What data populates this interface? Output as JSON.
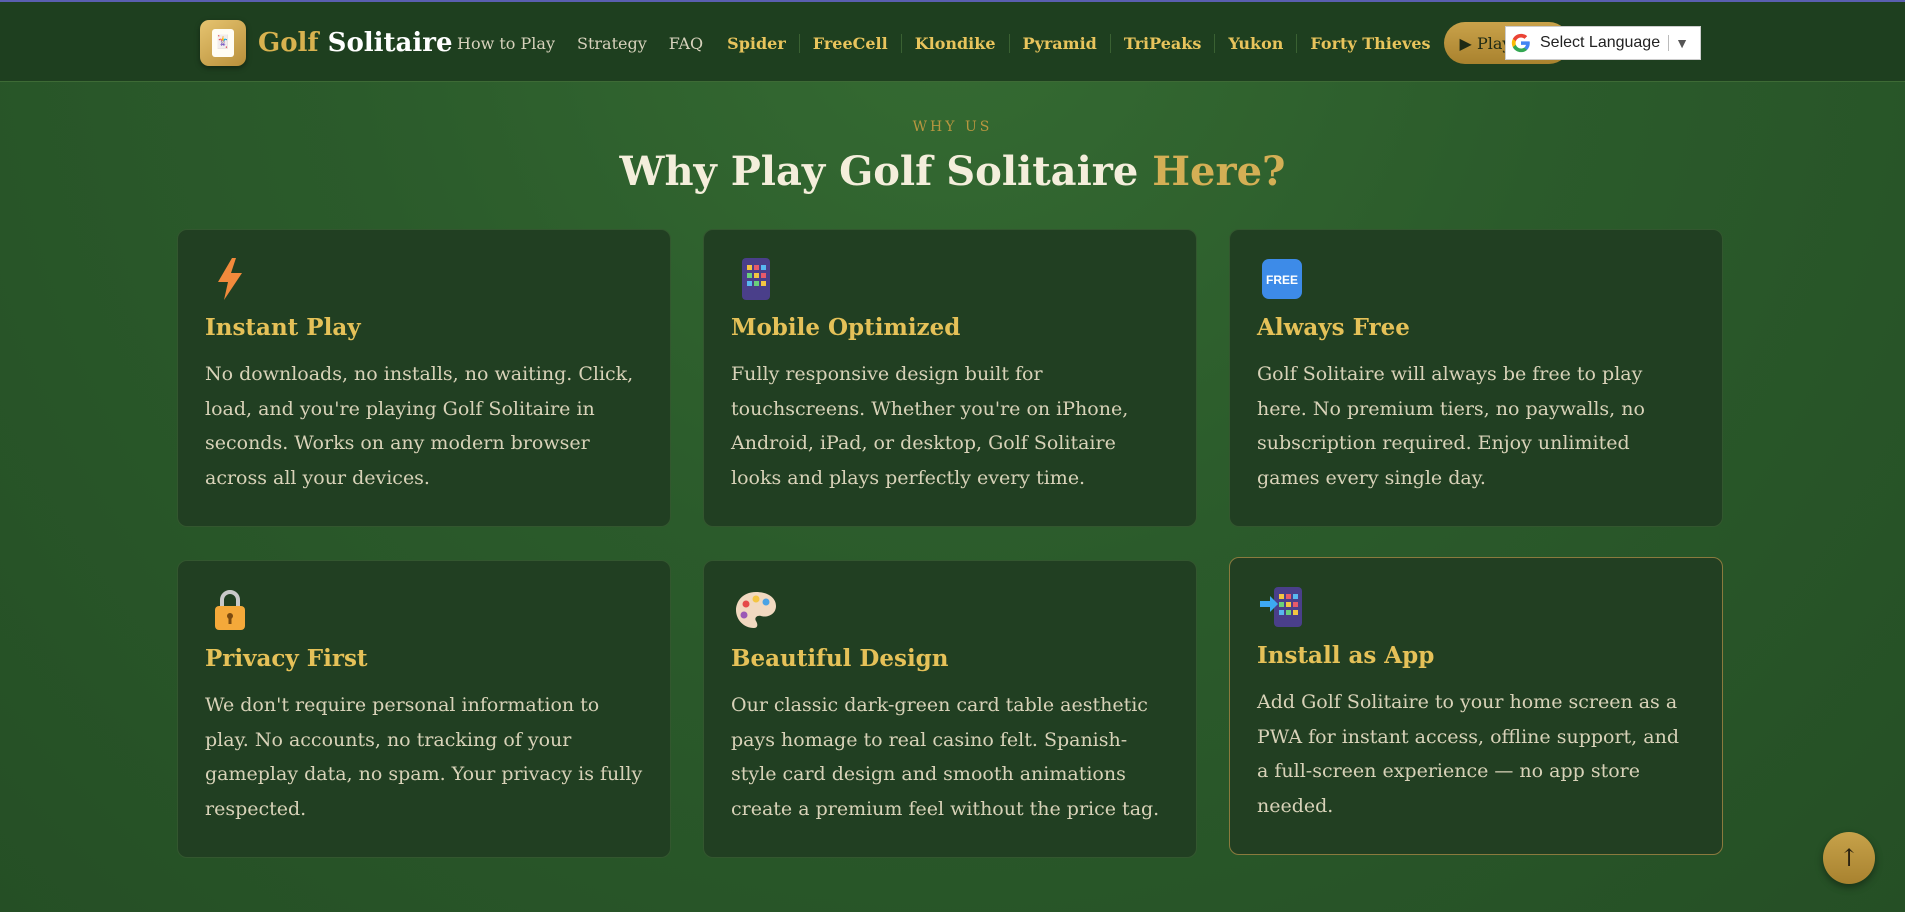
{
  "header": {
    "logo_golf": "Golf",
    "logo_solitaire": "Solitaire",
    "nav": [
      "How to Play",
      "Strategy",
      "FAQ"
    ],
    "games": [
      "Spider",
      "FreeCell",
      "Klondike",
      "Pyramid",
      "TriPeaks",
      "Yukon",
      "Forty Thieves"
    ],
    "play_button": "▶ Play Free",
    "language": "Select Language",
    "language_arrow": "▼"
  },
  "section": {
    "eyebrow": "WHY US",
    "title_main": "Why Play Golf Solitaire ",
    "title_accent": "Here?"
  },
  "cards": [
    {
      "icon": "lightning-icon",
      "title": "Instant Play",
      "text": "No downloads, no installs, no waiting. Click, load, and you're playing Golf Solitaire in seconds. Works on any modern browser across all your devices."
    },
    {
      "icon": "mobile-phone-icon",
      "title": "Mobile Optimized",
      "text": "Fully responsive design built for touchscreens. Whether you're on iPhone, Android, iPad, or desktop, Golf Solitaire looks and plays perfectly every time."
    },
    {
      "icon": "free-badge-icon",
      "title": "Always Free",
      "text": "Golf Solitaire will always be free to play here. No premium tiers, no paywalls, no subscription required. Enjoy unlimited games every single day."
    },
    {
      "icon": "padlock-icon",
      "title": "Privacy First",
      "text": "We don't require personal information to play. No accounts, no tracking of your gameplay data, no spam. Your privacy is fully respected."
    },
    {
      "icon": "palette-icon",
      "title": "Beautiful Design",
      "text": "Our classic dark-green card table aesthetic pays homage to real casino felt. Spanish-style card design and smooth animations create a premium feel without the price tag."
    },
    {
      "icon": "install-app-icon",
      "title": "Install as App",
      "text": "Add Golf Solitaire to your home screen as a PWA for instant access, offline support, and a full-screen experience — no app store needed."
    }
  ],
  "scroll_top": "↑",
  "colors": {
    "background": "#2b5b2b",
    "header": "#1e3f1f",
    "accent_gold": "#d4af55",
    "card": "#213f22"
  }
}
